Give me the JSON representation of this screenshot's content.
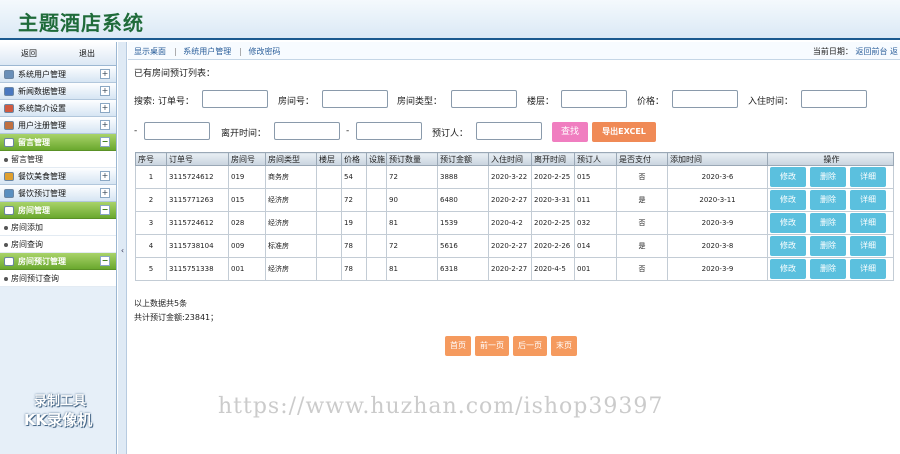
{
  "header": {
    "title": "主题酒店系统"
  },
  "sidebar": {
    "top_buttons": [
      "返回",
      "退出"
    ],
    "menus": [
      {
        "label": "系统用户管理",
        "icon": "gear-icon",
        "color": "#6a8fb8",
        "active": false,
        "subs": []
      },
      {
        "label": "新闻数据管理",
        "icon": "news-icon",
        "color": "#4a78c0",
        "active": false,
        "subs": []
      },
      {
        "label": "系统简介设置",
        "icon": "grid-icon",
        "color": "#d05a40",
        "active": false,
        "subs": []
      },
      {
        "label": "用户注册管理",
        "icon": "user-icon",
        "color": "#c07040",
        "active": false,
        "subs": []
      },
      {
        "label": "留言管理",
        "icon": "message-icon",
        "color": "#ffffff",
        "active": true,
        "subs": [
          "留言管理"
        ]
      },
      {
        "label": "餐饮美食管理",
        "icon": "folder-icon",
        "color": "#e0a030",
        "active": false,
        "subs": []
      },
      {
        "label": "餐饮预订管理",
        "icon": "edit-icon",
        "color": "#5a8fc0",
        "active": false,
        "subs": []
      },
      {
        "label": "房间管理",
        "icon": "chart-icon",
        "color": "#ffffff",
        "active": true,
        "subs": [
          "房间添加",
          "房间查询"
        ]
      },
      {
        "label": "房间预订管理",
        "icon": "calendar-icon",
        "color": "#ffffff",
        "active": true,
        "subs": [
          "房间预订查询"
        ]
      }
    ],
    "watermark_line1": "录制工具",
    "watermark_line2": "KK录像机"
  },
  "topbar": {
    "links": [
      "显示桌面",
      "系统用户管理",
      "修改密码"
    ],
    "date_label": "当前日期：",
    "back_link": "返回前台",
    "back_link_tail": "返"
  },
  "list_title": "已有房间预订列表：",
  "search": {
    "prefix": "搜索:",
    "labels": [
      "订单号：",
      "房间号：",
      "房间类型：",
      "楼层：",
      "价格：",
      "入住时间：",
      "-",
      "离开时间：",
      "-",
      "预订人："
    ],
    "search_button": "查找",
    "export_button": "导出EXCEL"
  },
  "table": {
    "headers": [
      "序号",
      "订单号",
      "房间号",
      "房间类型",
      "楼层",
      "价格",
      "设施",
      "预订数量",
      "预订金额",
      "入住时间",
      "离开时间",
      "预订人",
      "是否支付",
      "添加时间",
      "操作"
    ],
    "rows": [
      [
        "1",
        "3115724612",
        "019",
        "商务房",
        "",
        "54",
        "",
        "72",
        "3888",
        "2020-3-22",
        "2020-2-25",
        "015",
        "否",
        "2020-3-6"
      ],
      [
        "2",
        "3115771263",
        "015",
        "经济房",
        "",
        "72",
        "",
        "90",
        "6480",
        "2020-2-27",
        "2020-3-31",
        "011",
        "是",
        "2020-3-11"
      ],
      [
        "3",
        "3115724612",
        "028",
        "经济房",
        "",
        "19",
        "",
        "81",
        "1539",
        "2020-4-2",
        "2020-2-25",
        "032",
        "否",
        "2020-3-9"
      ],
      [
        "4",
        "3115738104",
        "009",
        "标准房",
        "",
        "78",
        "",
        "72",
        "5616",
        "2020-2-27",
        "2020-2-26",
        "014",
        "是",
        "2020-3-8"
      ],
      [
        "5",
        "3115751338",
        "001",
        "经济房",
        "",
        "78",
        "",
        "81",
        "6318",
        "2020-2-27",
        "2020-4-5",
        "001",
        "否",
        "2020-3-9"
      ]
    ],
    "ops": [
      "修改",
      "删除",
      "详细"
    ]
  },
  "summary": {
    "count_text": "以上数据共5条",
    "total_text": "共计预订金额:23841；"
  },
  "pager": [
    "首页",
    "前一页",
    "后一页",
    "末页"
  ],
  "url_watermark": "https://www.huzhan.com/ishop39397",
  "colors": {
    "accent": "#1b5a8f",
    "green_title": "#1f6b3a",
    "op_button": "#5bc0de",
    "search_button": "#f07ec0",
    "export_button": "#f08a56",
    "pager": "#f59a5e"
  }
}
